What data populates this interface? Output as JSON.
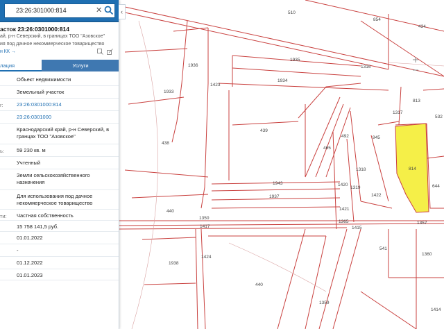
{
  "search": {
    "value": "23:26:301000:814"
  },
  "object": {
    "title": "асток 23:26:0301000:814",
    "subtitle": "ай, р-н Северский, в границах ТОО \"Азовское\"",
    "purpose": "ия под дачное некоммерческое товарищество",
    "link": "н КК →"
  },
  "tabs": {
    "info": "лация",
    "services": "Услуги"
  },
  "rows": [
    {
      "label": "",
      "value": "Объект недвижимости",
      "link": false
    },
    {
      "label": "",
      "value": "Земельный участок",
      "link": false
    },
    {
      "label": "r:",
      "value": "23:26:0301000:814",
      "link": true
    },
    {
      "label": "",
      "value": "23:26:0301000",
      "link": true
    },
    {
      "label": "",
      "value": "Краснодарский край, р-н Северский, в\nгранцах ТОО \"Азовское\"",
      "link": false
    },
    {
      "label": "ь:",
      "value": "59 230 кв. м",
      "link": false
    },
    {
      "label": "",
      "value": "Учтенный",
      "link": false
    },
    {
      "label": "",
      "value": "Земли сельскохозяйственного\nназначения",
      "link": false
    },
    {
      "label": "",
      "value": "Для использования под дачное\nнекоммерческое товарищество",
      "link": false
    },
    {
      "label": "ти:",
      "value": "Частная собственность",
      "link": false
    },
    {
      "label": "",
      "value": "15 758 141,5 руб.",
      "link": false
    },
    {
      "label": "",
      "value": "01.01.2022",
      "link": false
    },
    {
      "label": "",
      "value": "-",
      "link": false
    },
    {
      "label": "",
      "value": "01.12.2022",
      "link": false
    },
    {
      "label": "",
      "value": "01.01.2023",
      "link": false
    }
  ],
  "map_labels": [
    "510",
    "854",
    "434",
    "1316",
    "1935",
    "1936",
    "1423",
    "1933",
    "1934",
    "813",
    "532",
    "1317",
    "439",
    "945",
    "492",
    "438",
    "465",
    "1318",
    "1943",
    "1937",
    "814",
    "644",
    "1319",
    "1420",
    "1422",
    "1421",
    "440",
    "1350",
    "1365",
    "1417",
    "1415",
    "1357",
    "1424",
    "1938",
    "541",
    "1360",
    "440",
    "1359",
    "1414"
  ],
  "colors": {
    "accent": "#1f6fb2",
    "parcel_line": "#c9413f",
    "highlight": "#f5ef48"
  }
}
